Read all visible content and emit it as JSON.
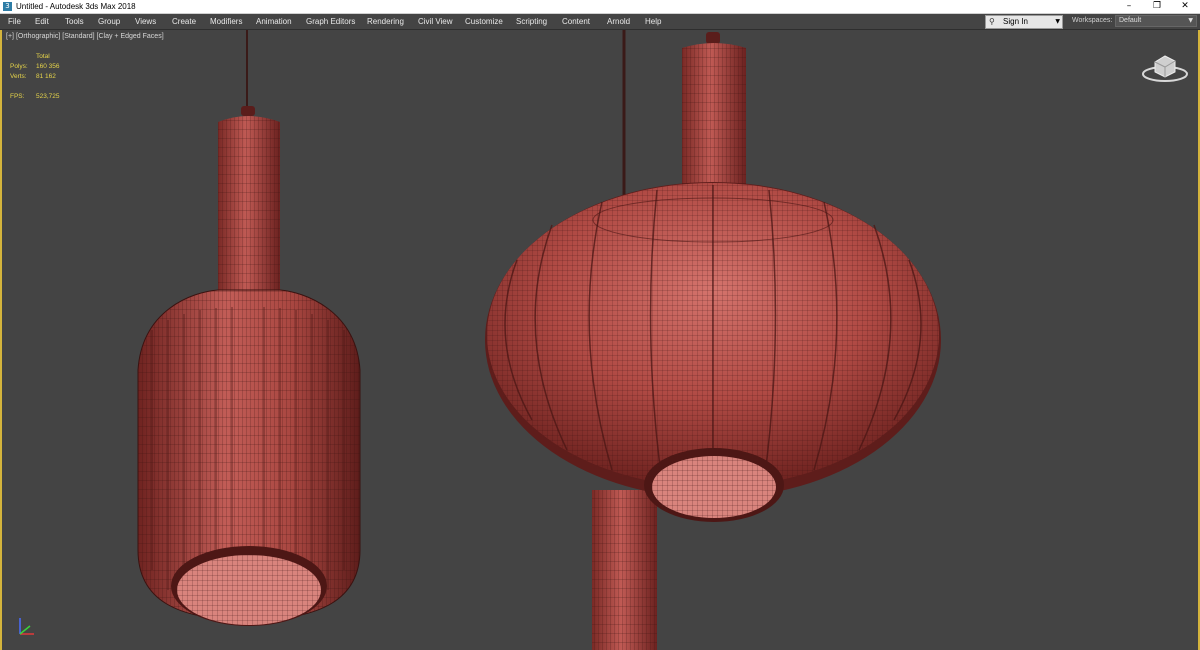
{
  "titlebar": {
    "title": "Untitled - Autodesk 3ds Max 2018",
    "minimize_glyph": "–",
    "restore_glyph": "❐",
    "close_glyph": "✕"
  },
  "menu": {
    "items": [
      "File",
      "Edit",
      "Tools",
      "Group",
      "Views",
      "Create",
      "Modifiers",
      "Animation",
      "Graph Editors",
      "Rendering",
      "Civil View",
      "Customize",
      "Scripting",
      "Content",
      "Arnold",
      "Help"
    ]
  },
  "account": {
    "signin_label": "Sign In",
    "workspaces_label": "Workspaces:",
    "workspace_value": "Default"
  },
  "viewport": {
    "label_parts": [
      "[+]",
      "[Orthographic]",
      "[Standard]",
      "[Clay + Edged Faces]"
    ],
    "stats": {
      "header": "Total",
      "polys_label": "Polys:",
      "polys_value": "160 356",
      "verts_label": "Verts:",
      "verts_value": "81 162",
      "fps_label": "FPS:",
      "fps_value": "523,725"
    },
    "colors": {
      "background": "#444444",
      "clay": "#b04a44",
      "wire": "#3a1210",
      "active_border": "#d4b43c",
      "stats_text": "#e6d44a"
    },
    "icons": {
      "viewcube": "viewcube-icon",
      "axis_gizmo": "axis-gizmo-icon"
    }
  }
}
